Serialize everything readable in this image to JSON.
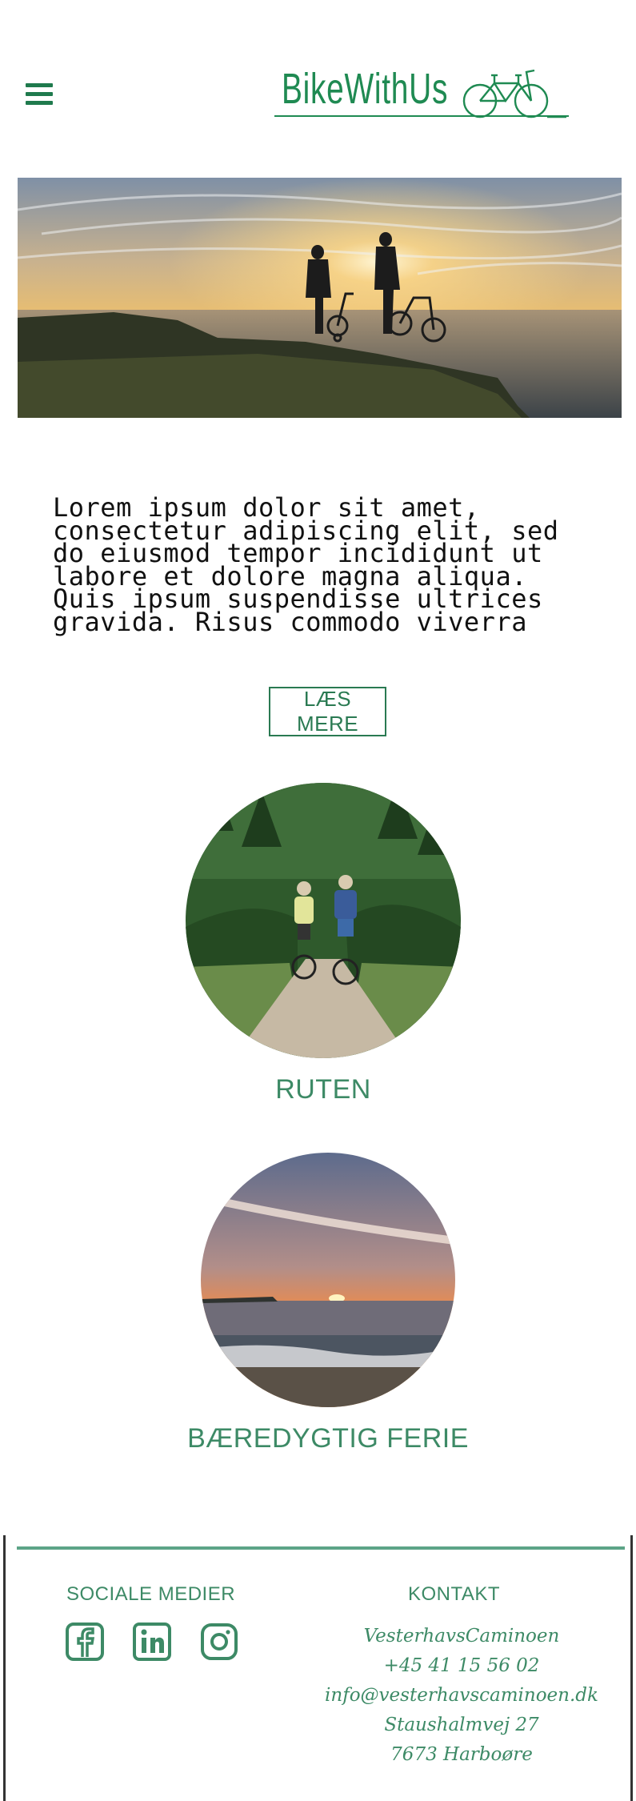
{
  "header": {
    "menu_icon": "hamburger-menu-icon",
    "logo_text": "BikeWithUs",
    "logo_icon": "tandem-bicycle-icon"
  },
  "intro": {
    "text": "Lorem ipsum dolor sit amet, consectetur adipiscing elit, sed do eiusmod tempor incididunt ut labore et dolore magna aliqua. Quis ipsum suspendisse ultrices gravida. Risus commodo viverra",
    "read_more_label": "LÆS MERE"
  },
  "cards": {
    "route_label": "RUTEN",
    "sustainable_label": "BÆREDYGTIG FERIE"
  },
  "footer": {
    "social_title": "SOCIALE MEDIER",
    "social_icons": [
      "facebook-icon",
      "linkedin-icon",
      "instagram-icon"
    ],
    "contact_title": "KONTAKT",
    "contact": {
      "name": "VesterhavsCaminoen",
      "phone": "+45 41 15 56 02",
      "email": "info@vesterhavscaminoen.dk",
      "street": "Staushalmvej 27",
      "city": "7673 Harboøre"
    }
  },
  "colors": {
    "brand_green": "#1f8a52",
    "label_green": "#3d8a66",
    "footer_line": "#5ca487"
  }
}
